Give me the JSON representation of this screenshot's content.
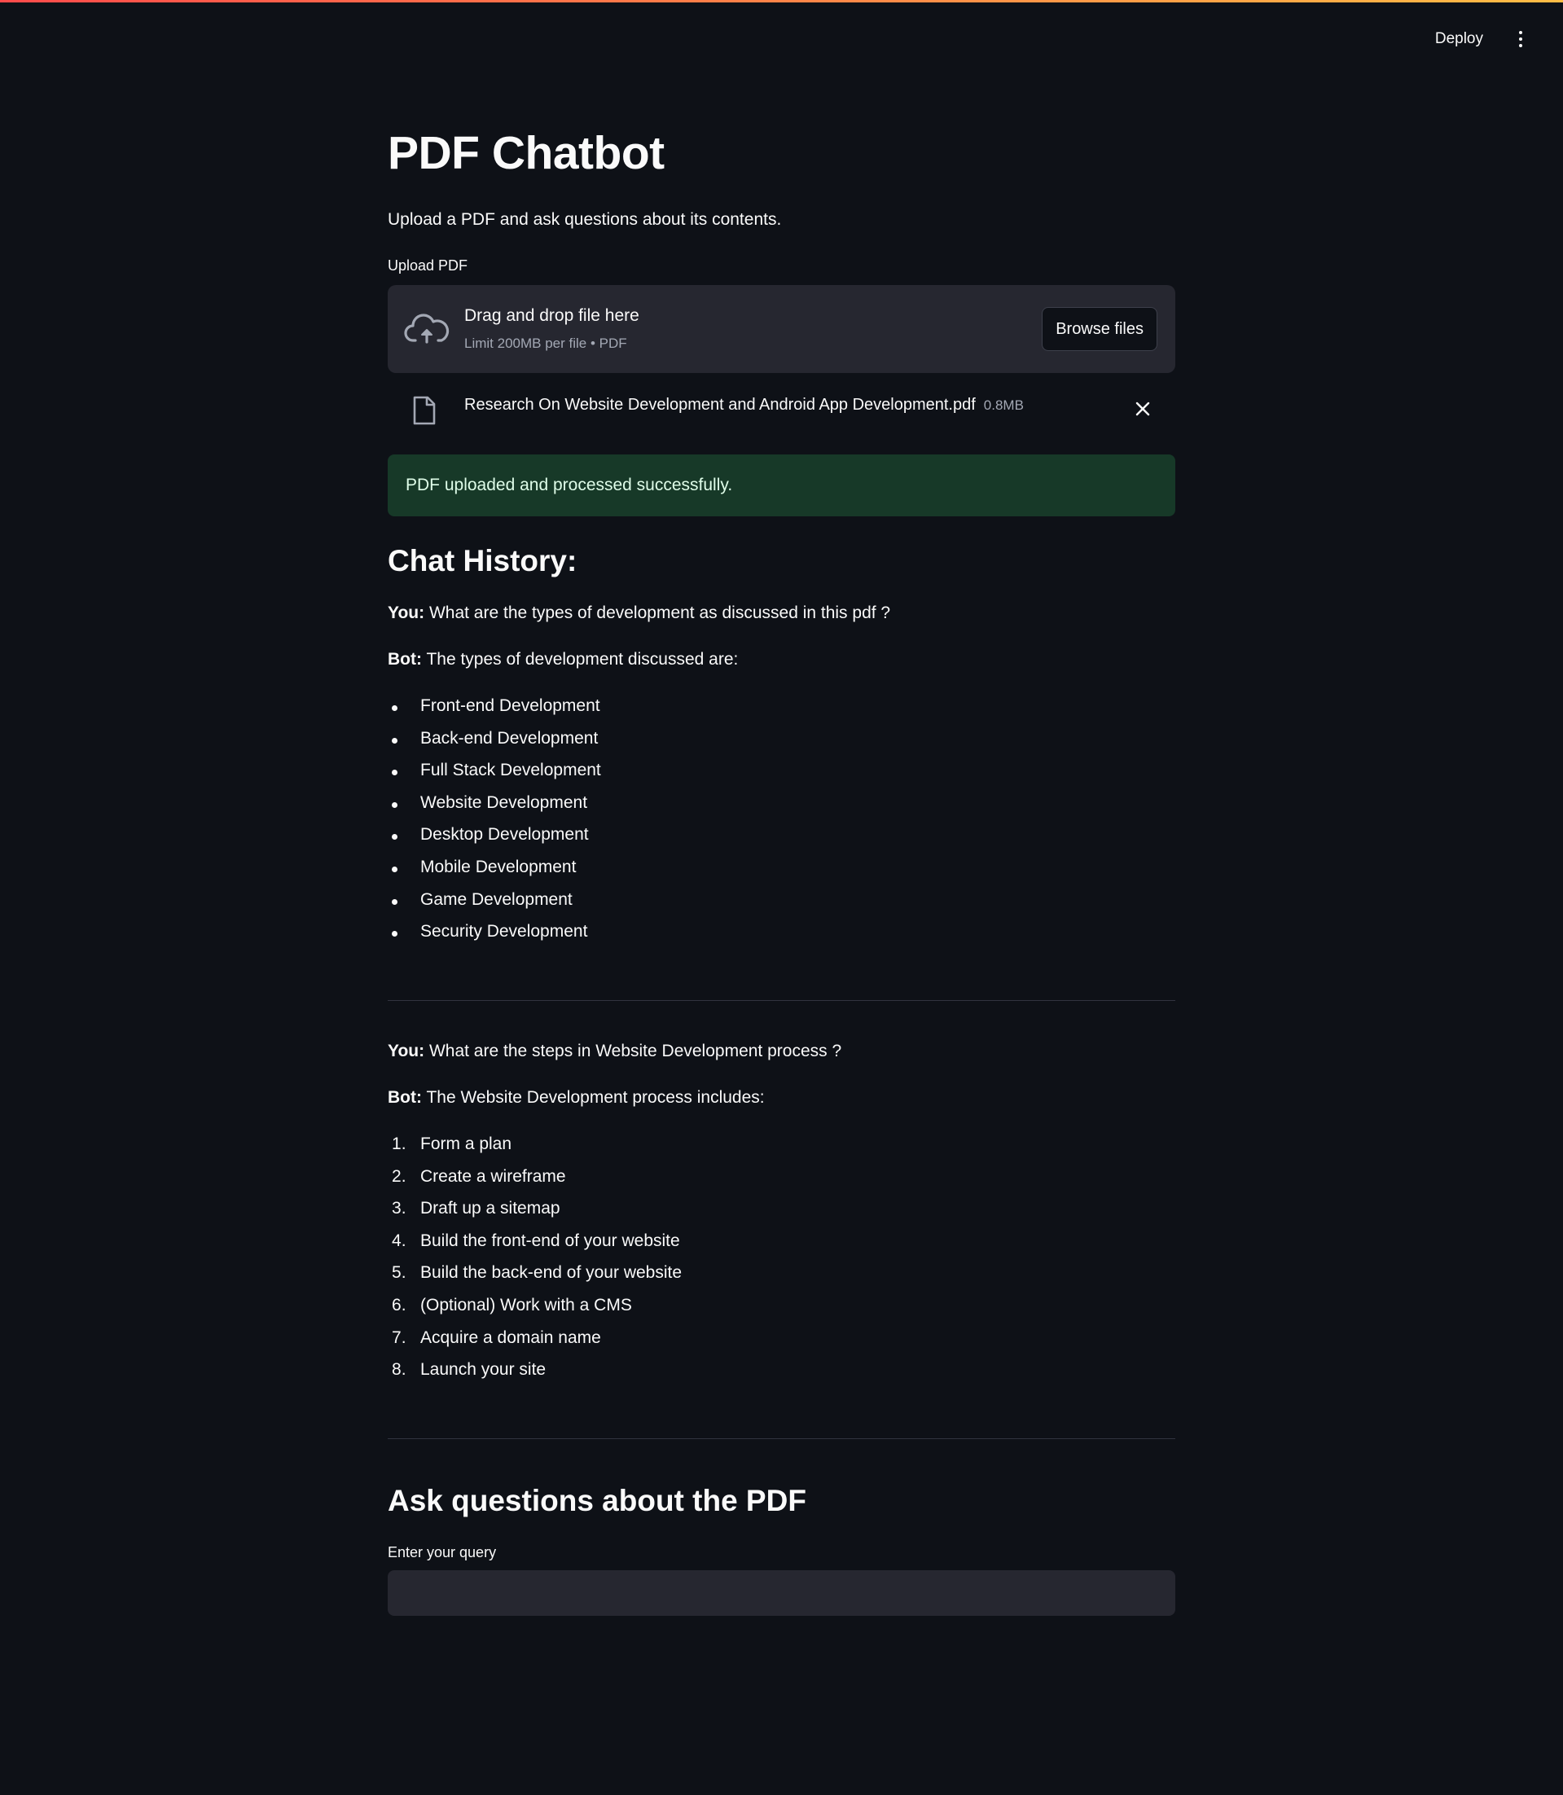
{
  "topbar": {
    "deploy_label": "Deploy",
    "menu_icon": "vertical-ellipsis-icon"
  },
  "app": {
    "title": "PDF Chatbot",
    "subtitle": "Upload a PDF and ask questions about its contents."
  },
  "uploader": {
    "label": "Upload PDF",
    "drop_title": "Drag and drop file here",
    "drop_limit": "Limit 200MB per file • PDF",
    "browse_label": "Browse files",
    "icon": "cloud-upload-icon"
  },
  "file": {
    "name": "Research On Website Development and Android App Development.pdf",
    "size": "0.8MB",
    "icon": "file-icon"
  },
  "alert": {
    "text": "PDF uploaded and processed successfully.",
    "color": "#173928"
  },
  "chat": {
    "heading": "Chat History:",
    "you_label": "You:",
    "bot_label": "Bot:",
    "exchanges": [
      {
        "question": "What are the types of development as discussed in this pdf ?",
        "answer_intro": "The types of development discussed are:",
        "items": [
          "Front-end Development",
          "Back-end Development",
          "Full Stack Development",
          "Website Development",
          "Desktop Development",
          "Mobile Development",
          "Game Development",
          "Security Development"
        ]
      },
      {
        "question": "What are the steps in Website Development process ?",
        "answer_intro": "The Website Development process includes:",
        "items": [
          "Form a plan",
          "Create a wireframe",
          "Draft up a sitemap",
          "Build the front-end of your website",
          "Build the back-end of your website",
          "(Optional) Work with a CMS",
          "Acquire a domain name",
          "Launch your site"
        ]
      }
    ]
  },
  "ask": {
    "heading": "Ask questions about the PDF",
    "query_label": "Enter your query",
    "query_value": ""
  },
  "colors": {
    "background": "#0e1117",
    "surface": "#262730",
    "text": "#fafafa",
    "muted": "#a3a8b4"
  }
}
